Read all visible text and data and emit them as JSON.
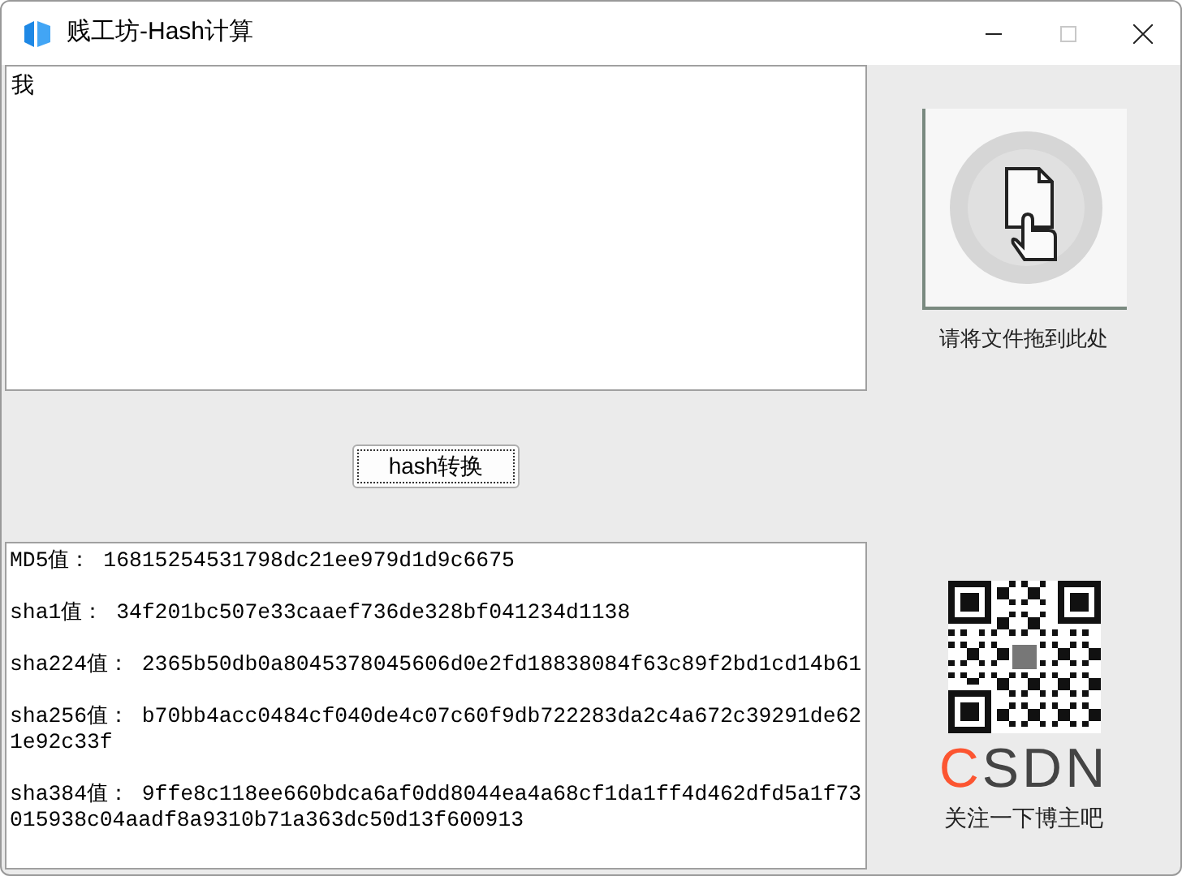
{
  "window": {
    "title": "贱工坊-Hash计算",
    "maximize_disabled": true
  },
  "input": {
    "value": "我"
  },
  "convert_button": {
    "label": "hash转换"
  },
  "results": [
    {
      "label": "MD5值：",
      "value": "16815254531798dc21ee979d1d9c6675"
    },
    {
      "label": "sha1值：",
      "value": "34f201bc507e33caaef736de328bf041234d1138"
    },
    {
      "label": "sha224值：",
      "value": "2365b50db0a8045378045606d0e2fd18838084f63c89f2bd1cd14b61"
    },
    {
      "label": "sha256值：",
      "value": "b70bb4acc0484cf040de4c07c60f9db722283da2c4a672c39291de621e92c33f"
    },
    {
      "label": "sha384值：",
      "value": "9ffe8c118ee660bdca6af0dd8044ea4a68cf1da1ff4d462dfd5a1f73015938c04aadf8a9310b71a363dc50d13f600913"
    }
  ],
  "drop_zone": {
    "caption": "请将文件拖到此处"
  },
  "promo": {
    "logo": "CSDN",
    "caption": "关注一下博主吧"
  }
}
